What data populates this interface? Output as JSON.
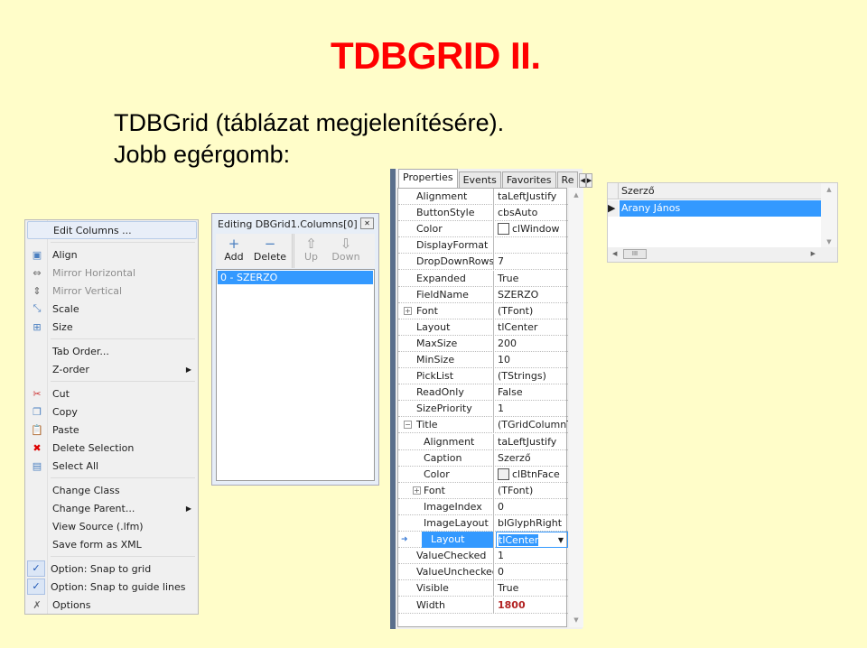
{
  "slide": {
    "title": "TDBGRID II.",
    "line1": "TDBGrid (táblázat megjelenítésére).",
    "line2": "Jobb egérgomb:"
  },
  "context_menu": [
    {
      "label": "Edit Columns ...",
      "icon": "",
      "highlight": true
    },
    {
      "sep": true
    },
    {
      "label": "Align",
      "icon": "align-icon"
    },
    {
      "label": "Mirror Horizontal",
      "icon": "mirror-horizontal-icon",
      "disabled": true
    },
    {
      "label": "Mirror Vertical",
      "icon": "mirror-vertical-icon",
      "disabled": true
    },
    {
      "label": "Scale",
      "icon": "scale-icon"
    },
    {
      "label": "Size",
      "icon": "size-icon"
    },
    {
      "sep": true
    },
    {
      "label": "Tab Order...",
      "icon": ""
    },
    {
      "label": "Z-order",
      "icon": "",
      "submenu": true
    },
    {
      "sep": true
    },
    {
      "label": "Cut",
      "icon": "scissors-icon"
    },
    {
      "label": "Copy",
      "icon": "copy-icon"
    },
    {
      "label": "Paste",
      "icon": "paste-icon"
    },
    {
      "label": "Delete Selection",
      "icon": "delete-icon"
    },
    {
      "label": "Select All",
      "icon": "select-all-icon"
    },
    {
      "sep": true
    },
    {
      "label": "Change Class",
      "icon": ""
    },
    {
      "label": "Change Parent...",
      "icon": "",
      "submenu": true
    },
    {
      "label": "View Source (.lfm)",
      "icon": ""
    },
    {
      "label": "Save form as XML",
      "icon": ""
    },
    {
      "sep": true
    },
    {
      "label": "Option: Snap to grid",
      "icon": "checkmark-icon",
      "checked": true
    },
    {
      "label": "Option: Snap to guide lines",
      "icon": "checkmark-icon",
      "checked": true
    },
    {
      "label": "Options",
      "icon": "tools-icon"
    }
  ],
  "column_editor": {
    "title": "Editing DBGrid1.Columns[0]",
    "buttons": [
      {
        "label": "Add",
        "glyph": "+"
      },
      {
        "label": "Delete",
        "glyph": "−"
      },
      {
        "label": "Up",
        "glyph": "⇧",
        "disabled": true
      },
      {
        "label": "Down",
        "glyph": "⇩",
        "disabled": true
      }
    ],
    "items": [
      "0 - SZERZO"
    ]
  },
  "inspector": {
    "tabs": [
      "Properties",
      "Events",
      "Favorites",
      "Re"
    ],
    "rows": [
      {
        "name": "Alignment",
        "value": "taLeftJustify"
      },
      {
        "name": "ButtonStyle",
        "value": "cbsAuto"
      },
      {
        "name": "Color",
        "value": "clWindow",
        "swatch": "#ffffff"
      },
      {
        "name": "DisplayFormat",
        "value": ""
      },
      {
        "name": "DropDownRows",
        "value": "7"
      },
      {
        "name": "Expanded",
        "value": "True"
      },
      {
        "name": "FieldName",
        "value": "SZERZO"
      },
      {
        "name": "Font",
        "value": "(TFont)",
        "expand": "+"
      },
      {
        "name": "Layout",
        "value": "tlCenter"
      },
      {
        "name": "MaxSize",
        "value": "200"
      },
      {
        "name": "MinSize",
        "value": "10"
      },
      {
        "name": "PickList",
        "value": "(TStrings)"
      },
      {
        "name": "ReadOnly",
        "value": "False"
      },
      {
        "name": "SizePriority",
        "value": "1"
      },
      {
        "name": "Title",
        "value": "(TGridColumnTi",
        "expand": "−"
      },
      {
        "name": "Alignment",
        "value": "taLeftJustify",
        "indent": true
      },
      {
        "name": "Caption",
        "value": "Szerző",
        "indent": true
      },
      {
        "name": "Color",
        "value": "clBtnFace",
        "indent": true,
        "swatch": "#f0f0f0"
      },
      {
        "name": "Font",
        "value": "(TFont)",
        "indent": true,
        "expand": "+"
      },
      {
        "name": "ImageIndex",
        "value": "0",
        "indent": true
      },
      {
        "name": "ImageLayout",
        "value": "blGlyphRight",
        "indent": true
      },
      {
        "name": "Layout",
        "value": "tlCenter",
        "indent": true,
        "selected": true
      },
      {
        "name": "ValueChecked",
        "value": "1"
      },
      {
        "name": "ValueUnchecked",
        "value": "0"
      },
      {
        "name": "Visible",
        "value": "True"
      },
      {
        "name": "Width",
        "value": "1800",
        "modified": true
      }
    ]
  },
  "dbgrid": {
    "header": "Szerző",
    "rows": [
      "Arany János"
    ]
  },
  "colors": {
    "title": "#ff0000",
    "background": "#fffdc9",
    "selection": "#3399ff",
    "modified": "#b22222"
  }
}
